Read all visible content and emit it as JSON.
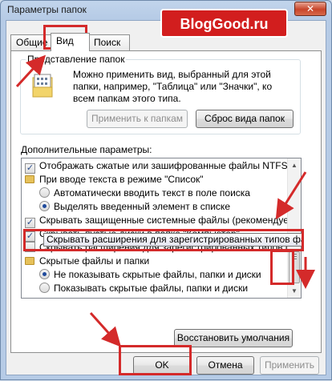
{
  "window": {
    "title": "Параметры папок",
    "close_label": "✕"
  },
  "brand": {
    "logo_text": "BlogGood.ru"
  },
  "tabs": [
    {
      "label": "Общие",
      "active": false
    },
    {
      "label": "Вид",
      "active": true
    },
    {
      "label": "Поиск",
      "active": false
    }
  ],
  "folder_view": {
    "legend": "Представление папок",
    "description": "Можно применить вид, выбранный для этой папки, например, \"Таблица\" или \"Значки\", ко всем папкам этого типа.",
    "apply_button": "Применить к папкам",
    "reset_button": "Сброс вида папок"
  },
  "advanced": {
    "label": "Дополнительные параметры:",
    "items": [
      {
        "kind": "checkbox",
        "checked": true,
        "indent": 0,
        "label": "Отображать сжатые или зашифрованные файлы NTFS д"
      },
      {
        "kind": "folder",
        "indent": 0,
        "label": "При вводе текста в режиме \"Список\""
      },
      {
        "kind": "radio",
        "checked": false,
        "indent": 1,
        "label": "Автоматически вводить текст в поле поиска"
      },
      {
        "kind": "radio",
        "checked": true,
        "indent": 1,
        "label": "Выделять введенный элемент в списке"
      },
      {
        "kind": "checkbox",
        "checked": true,
        "indent": 0,
        "label": "Скрывать защищенные системные файлы (рекомендуе"
      },
      {
        "kind": "checkbox",
        "checked": true,
        "indent": 0,
        "label": "Скрывать пустые диски в папке \"Компьютер\""
      },
      {
        "kind": "checkbox",
        "checked": false,
        "indent": 0,
        "label": "Скрывать расширения для зарегистрированных типов файлов"
      },
      {
        "kind": "folder",
        "indent": 0,
        "label": "Скрытые файлы и папки"
      },
      {
        "kind": "radio",
        "checked": true,
        "indent": 1,
        "label": "Не показывать скрытые файлы, папки и диски"
      },
      {
        "kind": "radio",
        "checked": false,
        "indent": 1,
        "label": "Показывать скрытые файлы, папки и диски"
      }
    ],
    "tooltip": "Скрывать расширения для зарегистрированных типов файлов",
    "restore_button": "Восстановить умолчания"
  },
  "footer": {
    "ok": "OK",
    "cancel": "Отмена",
    "apply": "Применить"
  },
  "colors": {
    "annotation": "#d42a2a",
    "logo_bg": "#d21e1e"
  }
}
